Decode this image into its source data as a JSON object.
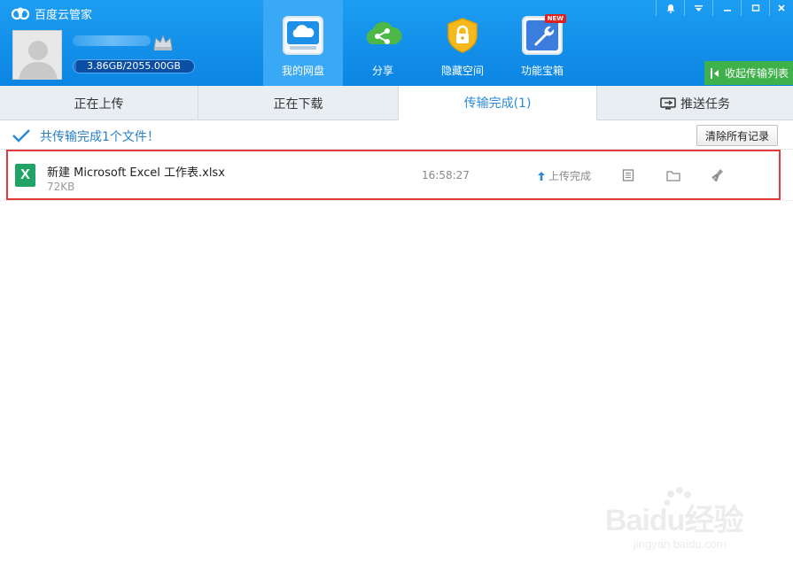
{
  "app": {
    "title": "百度云管家"
  },
  "user": {
    "quota_text": "3.86GB/2055.00GB",
    "quota_used_fraction": 0.0019
  },
  "nav": [
    {
      "label": "我的网盘",
      "icon": "cloud-drive-icon"
    },
    {
      "label": "分享",
      "icon": "share-icon"
    },
    {
      "label": "隐藏空间",
      "icon": "lock-shield-icon"
    },
    {
      "label": "功能宝箱",
      "icon": "wrench-toolbox-icon",
      "badge": "NEW"
    }
  ],
  "window_controls": [
    "bell-icon",
    "menu-dropdown-icon",
    "minimize-icon",
    "maximize-icon",
    "close-icon"
  ],
  "collapse_button": "收起传输列表",
  "tabs": [
    {
      "label": "正在上传"
    },
    {
      "label": "正在下载"
    },
    {
      "label": "传输完成(1)"
    },
    {
      "label": "推送任务"
    }
  ],
  "summary": {
    "text": "共传输完成1个文件！",
    "clear_button": "清除所有记录"
  },
  "files": [
    {
      "name": "新建 Microsoft Excel 工作表.xlsx",
      "size": "72KB",
      "time": "16:58:27",
      "status": "上传完成",
      "type_icon": "X"
    }
  ],
  "watermark": {
    "brand": "Baidu经验",
    "url": "jingyan.baidu.com"
  },
  "colors": {
    "header_blue": "#0c85e3",
    "active_tab_text": "#2b8ad8",
    "highlight_red": "#e13b3b",
    "excel_green": "#21a366",
    "collapse_green": "#3fb14a"
  }
}
